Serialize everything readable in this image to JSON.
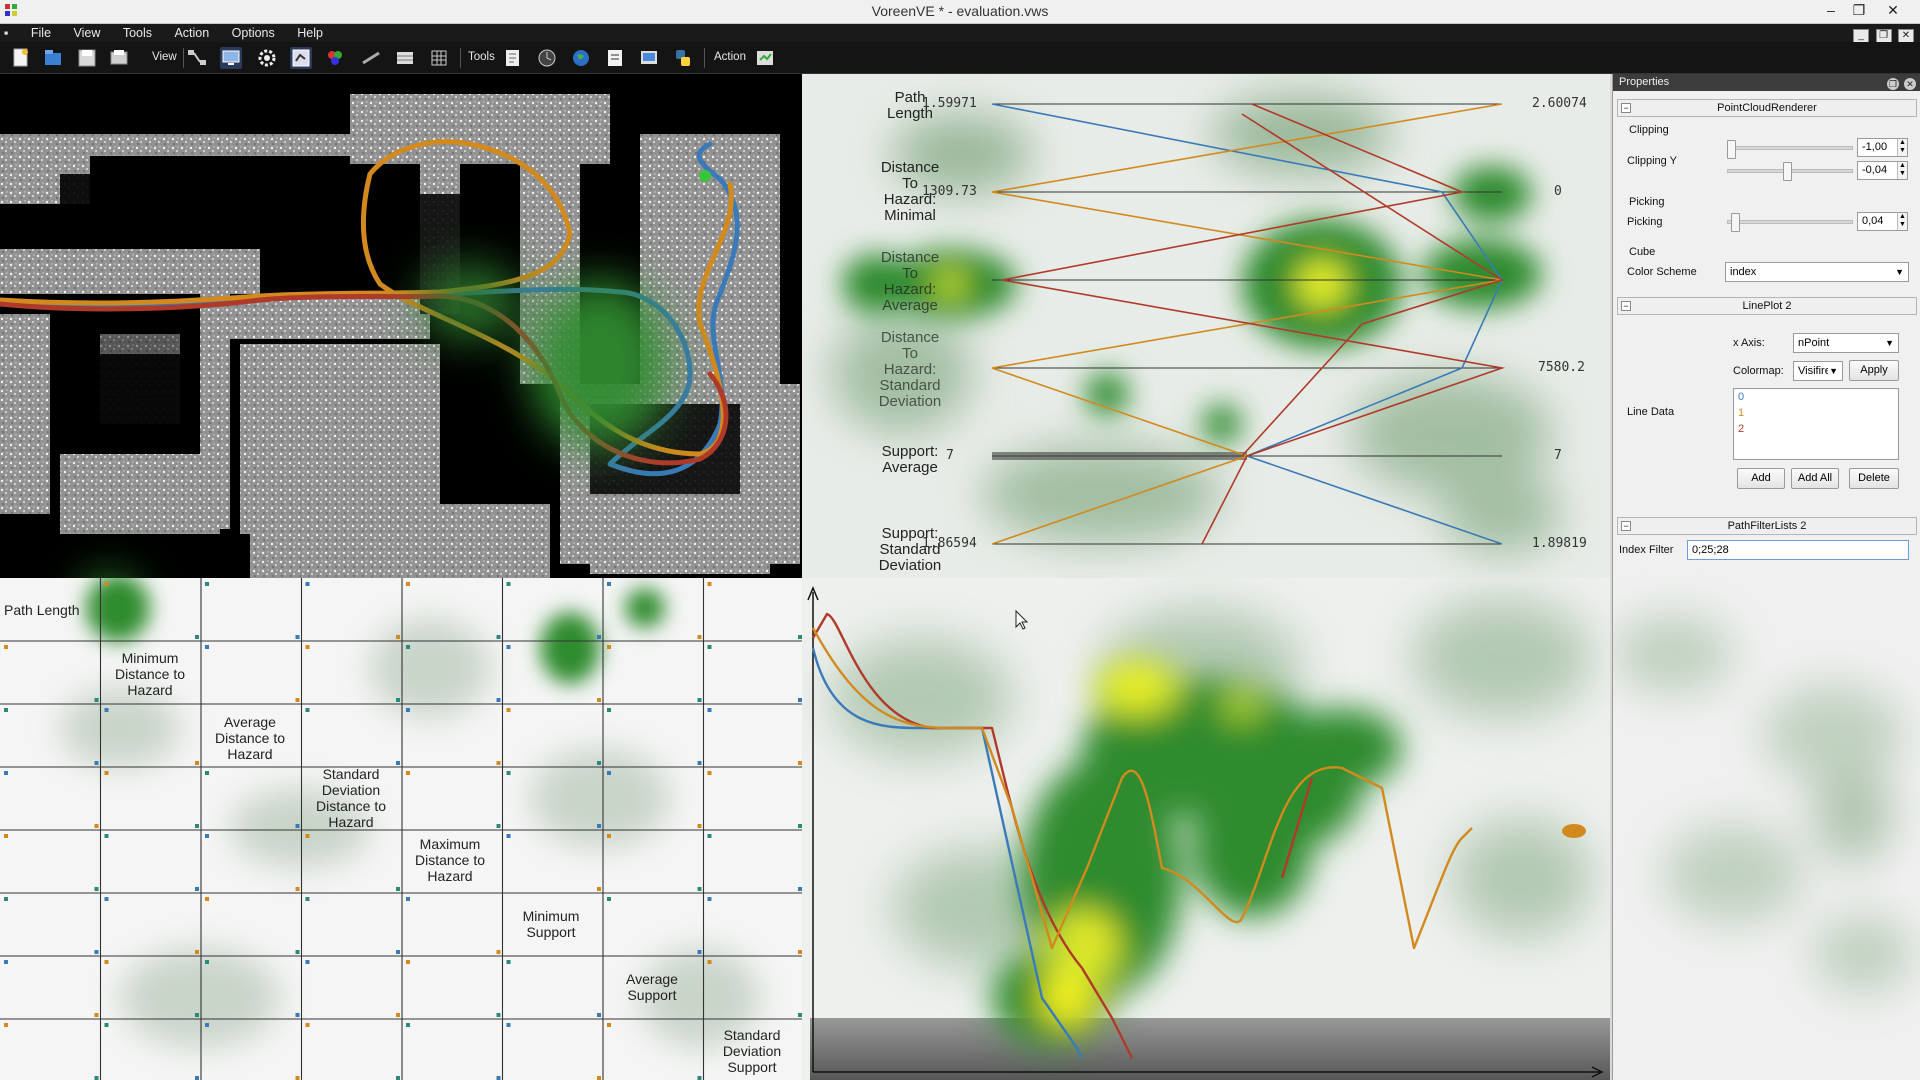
{
  "window": {
    "title": "VoreenVE * - evaluation.vws"
  },
  "menu": {
    "items": [
      "File",
      "View",
      "Tools",
      "Action",
      "Options",
      "Help"
    ]
  },
  "toolbar": {
    "view_label": "View",
    "tools_label": "Tools",
    "action_label": "Action",
    "icons": [
      "new-workspace-icon",
      "open-workspace-icon",
      "save-workspace-icon",
      "save-as-icon",
      "network-editor-icon",
      "canvas-icon",
      "settings-icon",
      "processors-icon",
      "render-target-icon",
      "volume-io-icon",
      "properties-icon",
      "grid-icon",
      "script-icon",
      "animation-icon",
      "globe-icon",
      "snapshot-icon",
      "remote-control-icon",
      "python-icon",
      "action-icon"
    ]
  },
  "parallel_coords": {
    "axes": [
      {
        "label": "Path\nLength",
        "min": "1.59971",
        "max": "2.60074"
      },
      {
        "label": "Distance\nTo\nHazard:\nMinimal",
        "min": "1309.73",
        "max": "0"
      },
      {
        "label": "Distance\nTo\nHazard:\nAverage",
        "min": "",
        "max": ""
      },
      {
        "label": "Distance\nTo\nHazard:\nStandard\nDeviation",
        "min": "",
        "max": "7580.2"
      },
      {
        "label": "Support:\nAverage",
        "min": "7",
        "max": "7"
      },
      {
        "label": "Support:\nStandard\nDeviation",
        "min": "1.86594",
        "max": "1.89819"
      }
    ]
  },
  "scatter_matrix": {
    "labels": [
      "Path Length",
      "Minimum\nDistance to\nHazard",
      "Average\nDistance to\nHazard",
      "Standard\nDeviation\nDistance to\nHazard",
      "Maximum\nDistance to\nHazard",
      "Minimum\nSupport",
      "Average\nSupport",
      "Standard\nDeviation\nSupport"
    ]
  },
  "properties": {
    "header": "Properties",
    "pointcloud": {
      "title": "PointCloudRenderer",
      "clipping_group": "Clipping",
      "clipping_y_label": "Clipping Y",
      "clipping_y_min": "-1,00",
      "clipping_y_max": "-0,04",
      "picking_group": "Picking",
      "picking_label": "Picking",
      "picking_value": "0,04",
      "cube_group": "Cube",
      "color_scheme_label": "Color Scheme",
      "color_scheme_value": "index"
    },
    "lineplot": {
      "title": "LinePlot 2",
      "x_axis_label": "x Axis:",
      "x_axis_value": "nPoint",
      "colormap_label": "Colormap:",
      "colormap_value": "Visifire",
      "apply_label": "Apply",
      "line_data_label": "Line Data",
      "line_data": [
        "0",
        "1",
        "2"
      ],
      "add_label": "Add",
      "add_all_label": "Add All",
      "delete_label": "Delete"
    },
    "pathfilter": {
      "title": "PathFilterLists 2",
      "index_filter_label": "Index Filter",
      "index_filter_value": "0;25;28"
    }
  },
  "colors": {
    "path_blue": "#3a7ab8",
    "path_orange": "#d28a1e",
    "path_red": "#b03a2a",
    "heat_green": "#2e8b2e",
    "heat_yellow": "#f2f21a"
  }
}
